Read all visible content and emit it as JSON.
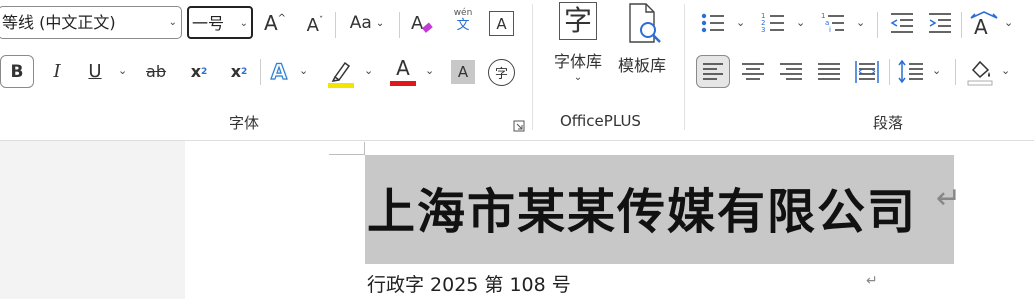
{
  "font": {
    "name_value": "等线 (中文正文)",
    "size_value": "一号",
    "grow_label": "A",
    "shrink_label": "A",
    "case_label": "Aa",
    "phonetic_top": "wén",
    "phonetic_bottom": "文",
    "border_char_label": "A",
    "bold_label": "B",
    "italic_label": "I",
    "underline_label": "U",
    "strike_label": "ab",
    "subscript_label": "x",
    "subscript_small": "2",
    "superscript_label": "x",
    "superscript_small": "2",
    "text_effect_label": "A",
    "font_color_label": "A",
    "char_shading_label": "A",
    "enclose_label": "字",
    "group_label": "字体"
  },
  "officeplus": {
    "font_library_icon_text": "字",
    "font_library_label": "字体库",
    "template_library_label": "模板库",
    "group_label": "OfficePLUS"
  },
  "paragraph": {
    "group_label": "段落"
  },
  "colors": {
    "highlight": "#f2e600",
    "font_color": "#e0181b",
    "text_effect": "#2f80d0"
  },
  "document": {
    "title": "上海市某某传媒有限公司",
    "subtitle": "行政字 2025 第 108 号",
    "paragraph_mark": "↵"
  }
}
